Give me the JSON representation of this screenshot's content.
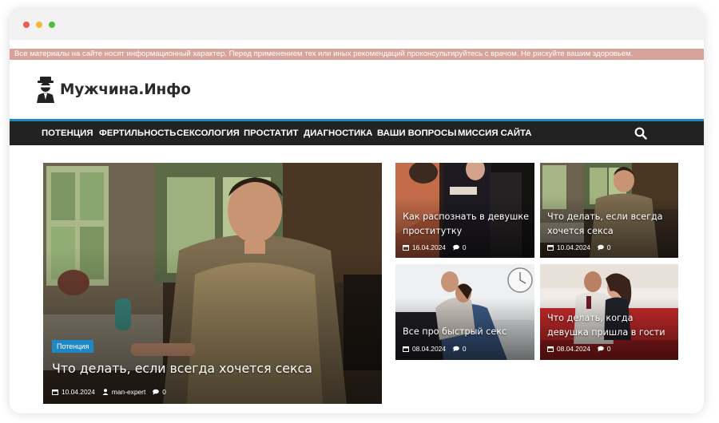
{
  "disclaimer": "Все материалы на сайте носят информационный характер. Перед применением тех или иных рекомендаций проконсультируйтесь с врачом. Не рискуйте вашим здоровьем.",
  "site": {
    "name": "Мужчина.Инфо"
  },
  "nav": {
    "items": [
      "ПОТЕНЦИЯ",
      "ФЕРТИЛЬНОСТЬ",
      "СЕКСОЛОГИЯ",
      "ПРОСТАТИТ",
      "ДИАГНОСТИКА",
      "ВАШИ ВОПРОСЫ",
      "МИССИЯ САЙТА"
    ],
    "search_icon": "search-icon"
  },
  "featured": {
    "category": "Потенция",
    "title": "Что делать, если всегда хочется секса",
    "date": "10.04.2024",
    "author": "man-expert",
    "comments": "0"
  },
  "cards": [
    {
      "title": "Как распознать в девушке проститутку",
      "date": "16.04.2024",
      "comments": "0"
    },
    {
      "title": "Что делать, если всегда хочется секса",
      "date": "10.04.2024",
      "comments": "0"
    },
    {
      "title": "Все про быстрый секс",
      "date": "08.04.2024",
      "comments": "0"
    },
    {
      "title": "Что делать, когда девушка пришла в гости",
      "date": "08.04.2024",
      "comments": "0"
    }
  ],
  "colors": {
    "accent": "#1e88c7",
    "nav_bg": "#222222",
    "disclaimer_bg": "#d8a39a"
  }
}
